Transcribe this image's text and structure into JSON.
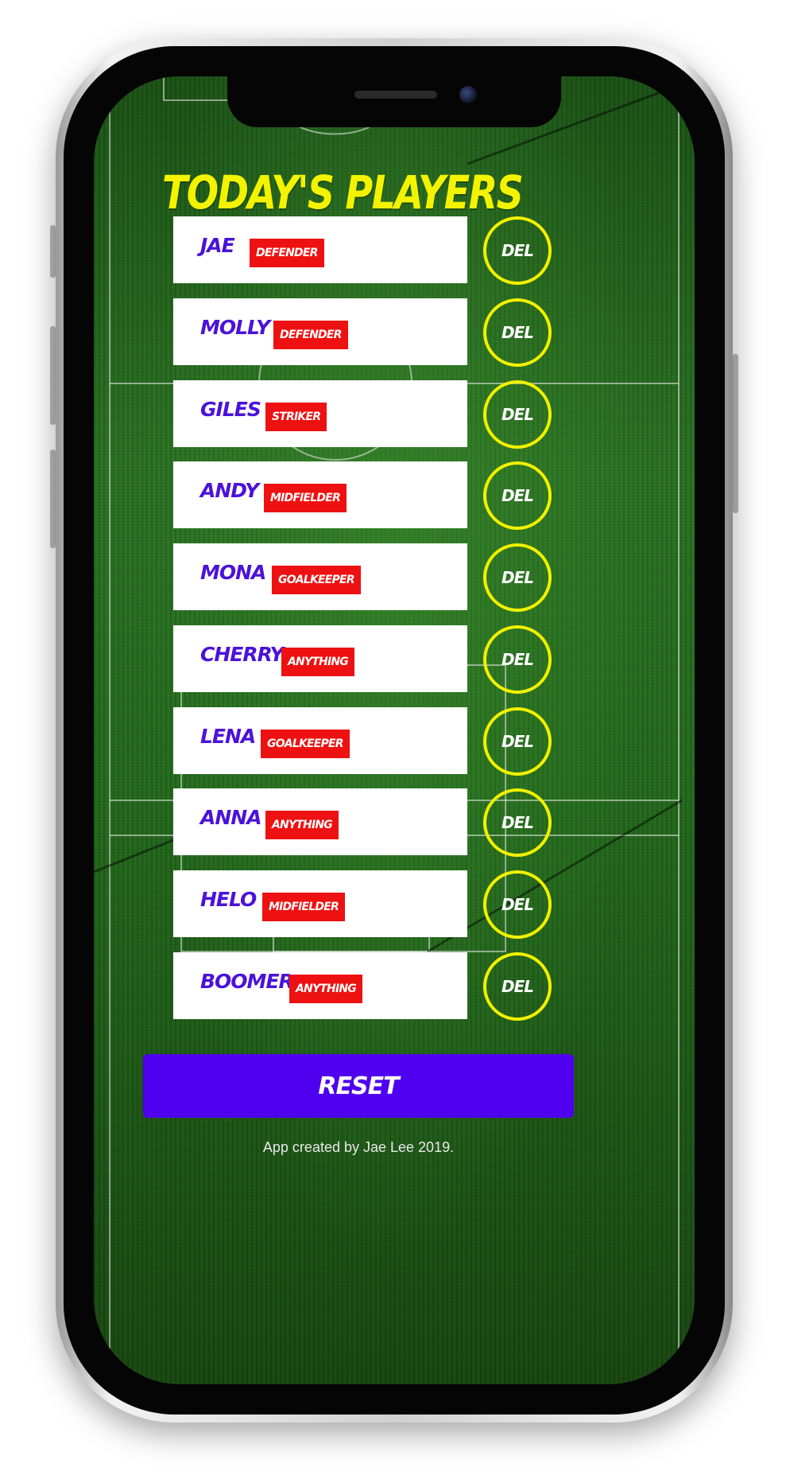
{
  "title": "Today's Players",
  "players": [
    {
      "name": "Jae",
      "position": "Defender",
      "delete_label": "Del"
    },
    {
      "name": "Molly",
      "position": "Defender",
      "delete_label": "Del"
    },
    {
      "name": "Giles",
      "position": "Striker",
      "delete_label": "Del"
    },
    {
      "name": "Andy",
      "position": "Midfielder",
      "delete_label": "Del"
    },
    {
      "name": "Mona",
      "position": "Goalkeeper",
      "delete_label": "Del"
    },
    {
      "name": "Cherry",
      "position": "Anything",
      "delete_label": "Del"
    },
    {
      "name": "Lena",
      "position": "Goalkeeper",
      "delete_label": "Del"
    },
    {
      "name": "Anna",
      "position": "Anything",
      "delete_label": "Del"
    },
    {
      "name": "Helo",
      "position": "Midfielder",
      "delete_label": "Del"
    },
    {
      "name": "Boomer",
      "position": "Anything",
      "delete_label": "Del"
    }
  ],
  "reset_label": "Reset",
  "footer": "App created by Jae Lee 2019.",
  "colors": {
    "title": "#f3f300",
    "player_name": "#4b12d9",
    "badge": "#ee1111",
    "del_ring": "#f1f100",
    "reset_button": "#4f00ee",
    "pitch": "#236a1c"
  }
}
